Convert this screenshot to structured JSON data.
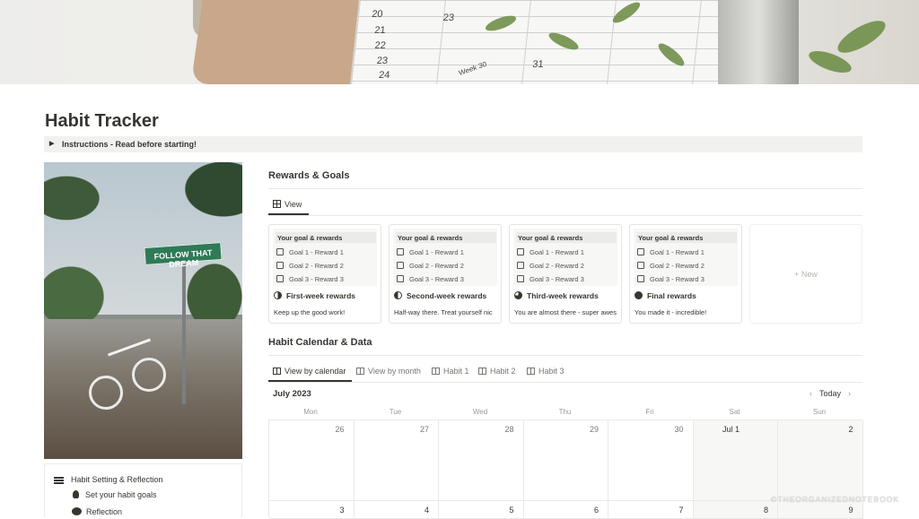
{
  "banner": {
    "calendar_numbers": [
      "20",
      "21",
      "22",
      "23",
      "24",
      "23",
      "31",
      "Week 30"
    ]
  },
  "page": {
    "title": "Habit Tracker",
    "toggle_label": "Instructions - Read before starting!"
  },
  "photo": {
    "sign_text": "FOLLOW THAT DREAM"
  },
  "sidebar": {
    "heading": "Habit Setting & Reflection",
    "items": [
      {
        "label": "Set your habit goals",
        "icon": "lightbulb-icon"
      },
      {
        "label": "Reflection",
        "icon": "thought-bubble-icon"
      }
    ]
  },
  "rewards": {
    "heading": "Rewards & Goals",
    "view_tab": "View",
    "cards": [
      {
        "header": "Your goal & rewards",
        "goals": [
          "Goal 1 - Reward 1",
          "Goal 2 - Reward 2",
          "Goal 3 - Reward 3"
        ],
        "name": "First-week rewards",
        "icon": "quarter-moon-icon",
        "desc": "Keep up the good work!"
      },
      {
        "header": "Your goal & rewards",
        "goals": [
          "Goal 1 - Reward 1",
          "Goal 2 - Reward 2",
          "Goal 3 - Reward 3"
        ],
        "name": "Second-week rewards",
        "icon": "half-moon-icon",
        "desc": "Half-way there. Treat yourself nic"
      },
      {
        "header": "Your goal & rewards",
        "goals": [
          "Goal 1 - Reward 1",
          "Goal 2 - Reward 2",
          "Goal 3 - Reward 3"
        ],
        "name": "Third-week rewards",
        "icon": "three-quarter-moon-icon",
        "desc": "You are almost there - super awes"
      },
      {
        "header": "Your goal & rewards",
        "goals": [
          "Goal 1 - Reward 1",
          "Goal 2 - Reward 2",
          "Goal 3 - Reward 3"
        ],
        "name": "Final rewards",
        "icon": "full-circle-icon",
        "desc": "You made it - incredible!"
      }
    ],
    "new_label": "+ New"
  },
  "habit_calendar": {
    "heading": "Habit Calendar & Data",
    "tabs": [
      "View by calendar",
      "View by month",
      "Habit 1",
      "Habit 2",
      "Habit 3"
    ],
    "month": "July 2023",
    "today_label": "Today",
    "prev_icon": "chevron-left-icon",
    "next_icon": "chevron-right-icon",
    "weekdays": [
      "Mon",
      "Tue",
      "Wed",
      "Thu",
      "Fri",
      "Sat",
      "Sun"
    ],
    "week1": [
      "26",
      "27",
      "28",
      "29",
      "30",
      "Jul 1",
      "2"
    ],
    "week2": [
      "3",
      "4",
      "5",
      "6",
      "7",
      "8",
      "9"
    ]
  },
  "watermark": "©THEORGANIZEDNOTEBOOK"
}
